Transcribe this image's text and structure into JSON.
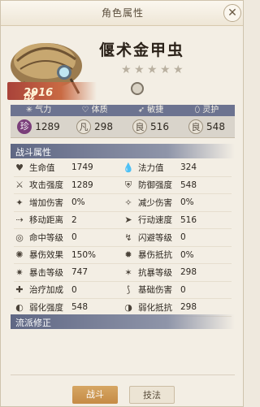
{
  "window": {
    "title": "角色属性",
    "close_icon": "close-icon"
  },
  "character": {
    "name": "偃术金甲虫",
    "power_label": "战力",
    "power_value": "2916",
    "stars_filled": 0,
    "stars_total": 5
  },
  "attributes": {
    "categories": [
      {
        "label": "气力",
        "icon": "qi-icon"
      },
      {
        "label": "体质",
        "icon": "heart-icon"
      },
      {
        "label": "敏捷",
        "icon": "wing-icon"
      },
      {
        "label": "灵护",
        "icon": "shield-icon"
      }
    ],
    "values": [
      {
        "badge": "珍",
        "value": "1289"
      },
      {
        "badge": "凡",
        "value": "298"
      },
      {
        "badge": "良",
        "value": "516"
      },
      {
        "badge": "良",
        "value": "548"
      }
    ]
  },
  "combat": {
    "title": "战斗属性",
    "rows": [
      {
        "l_label": "生命值",
        "l_val": "1749",
        "l_icon": "heart-icon",
        "r_label": "法力值",
        "r_val": "324",
        "r_icon": "drop-icon"
      },
      {
        "l_label": "攻击强度",
        "l_val": "1289",
        "l_icon": "sword-icon",
        "r_label": "防御强度",
        "r_val": "548",
        "r_icon": "shield-icon"
      },
      {
        "l_label": "增加伤害",
        "l_val": "0%",
        "l_icon": "sword-plus-icon",
        "r_label": "减少伤害",
        "r_val": "0%",
        "r_icon": "shield-minus-icon"
      },
      {
        "l_label": "移动距离",
        "l_val": "2",
        "l_icon": "boot-icon",
        "r_label": "行动速度",
        "r_val": "516",
        "r_icon": "speed-icon"
      },
      {
        "l_label": "命中等级",
        "l_val": "0",
        "l_icon": "target-icon",
        "r_label": "闪避等级",
        "r_val": "0",
        "r_icon": "dodge-icon"
      },
      {
        "l_label": "暴伤效果",
        "l_val": "150%",
        "l_icon": "burst-icon",
        "r_label": "暴伤抵抗",
        "r_val": "0%",
        "r_icon": "resist-icon"
      },
      {
        "l_label": "暴击等级",
        "l_val": "747",
        "l_icon": "crit-icon",
        "r_label": "抗暴等级",
        "r_val": "298",
        "r_icon": "anti-crit-icon"
      },
      {
        "l_label": "治疗加成",
        "l_val": "0",
        "l_icon": "heal-icon",
        "r_label": "基础伤害",
        "r_val": "0",
        "r_icon": "claw-icon"
      },
      {
        "l_label": "弱化强度",
        "l_val": "548",
        "l_icon": "weaken-icon",
        "r_label": "弱化抵抗",
        "r_val": "298",
        "r_icon": "weaken-resist-icon"
      }
    ]
  },
  "school": {
    "title": "流派修正"
  },
  "tabs": [
    {
      "label": "战斗",
      "active": true
    },
    {
      "label": "技法",
      "active": false
    }
  ],
  "colors": {
    "header_bar": "#6c7390",
    "active_tab": "#c58b45",
    "power_banner": "#a9433a"
  }
}
